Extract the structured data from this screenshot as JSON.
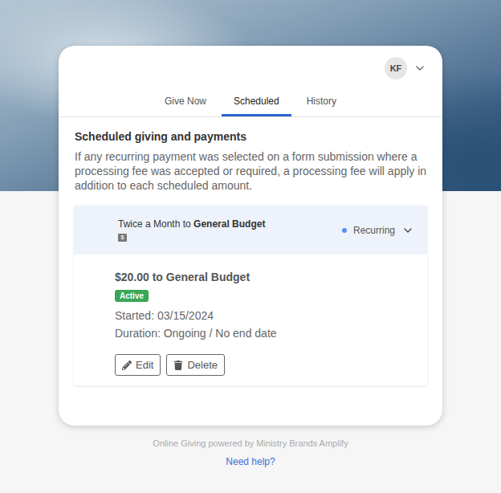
{
  "user": {
    "initials": "KF"
  },
  "tabs": [
    {
      "label": "Give Now",
      "selected": false
    },
    {
      "label": "Scheduled",
      "selected": true
    },
    {
      "label": "History",
      "selected": false
    }
  ],
  "heading": "Scheduled giving and payments",
  "notice": "If any recurring payment was selected on a form submission where a processing fee was accepted or required, a processing fee will apply in addition to each scheduled amount.",
  "schedules": [
    {
      "frequency": "Twice a Month to",
      "fund": "General Budget",
      "badge": "$",
      "type": "Recurring",
      "expanded": true,
      "amount": "$20.00 to General Budget",
      "status": "Active",
      "started": "Started: 03/15/2024",
      "duration": "Duration: Ongoing / No end date",
      "actions": [
        "Edit",
        "Delete"
      ]
    }
  ],
  "footer": {
    "powered_by": "Online Giving powered by Ministry Brands Amplify",
    "help": "Need help?"
  }
}
